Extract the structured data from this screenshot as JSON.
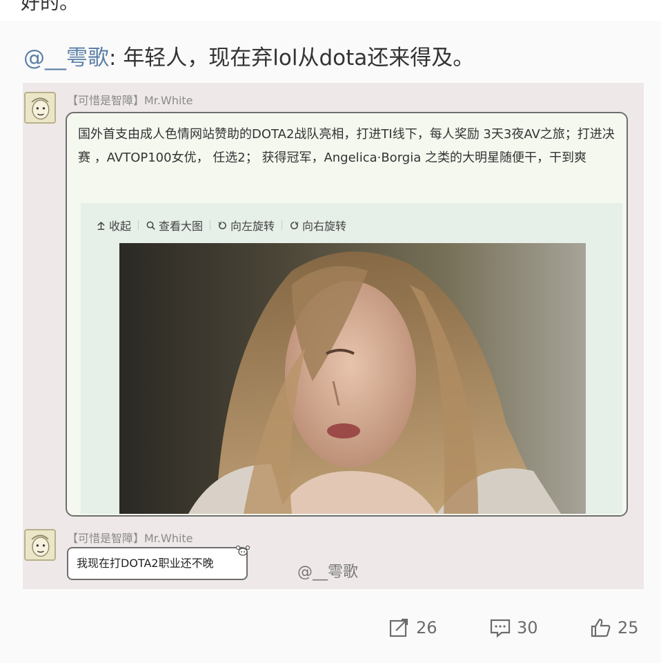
{
  "top_clipped_text": "好的。",
  "comment": {
    "mention": "@__雩歌",
    "colon": ":",
    "text": "年轻人，现在弃lol从dota还来得及。"
  },
  "retweet": {
    "post1": {
      "username": "【可惜是智障】Mr.White",
      "text": "国外首支由成人色情网站赞助的DOTA2战队亮相，打进TI线下，每人奖励 3天3夜AV之旅；打进决赛 ，AVTOP100女优， 任选2； 获得冠军，Angelica·Borgia 之类的大明星随便干，干到爽",
      "toolbar": {
        "collapse": "收起",
        "view_large": "查看大图",
        "rotate_left": "向左旋转",
        "rotate_right": "向右旋转"
      }
    },
    "post2": {
      "username": "【可惜是智障】Mr.White",
      "text": "我现在打DOTA2职业还不晚",
      "mention": "@__雩歌"
    }
  },
  "actions": {
    "repost_count": "26",
    "comment_count": "30",
    "like_count": "25"
  },
  "colors": {
    "mention": "#5b7fa6",
    "retweet_bg": "#efe8e8",
    "bubble_bg": "#f4f8ef"
  }
}
